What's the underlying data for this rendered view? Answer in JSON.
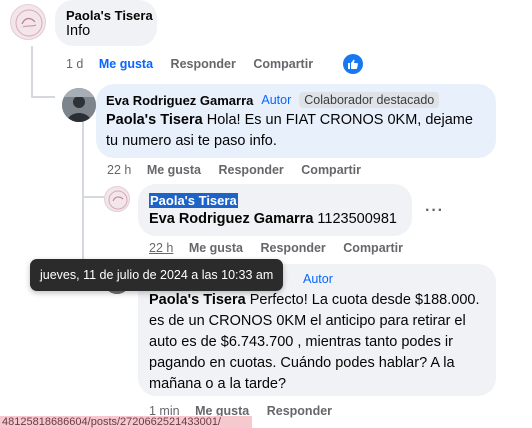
{
  "comments": {
    "c1": {
      "author": "Paola's Tisera",
      "text": "Info",
      "actions": {
        "time": "1 d",
        "like": "Me gusta",
        "reply": "Responder",
        "share": "Compartir"
      },
      "avatar_icon": "paola-logo-avatar"
    },
    "c2": {
      "author": "Eva Rodriguez Gamarra",
      "badge_author": "Autor",
      "badge_top": "Colaborador destacado",
      "mention": "Paola's Tisera",
      "text": " Hola! Es un FIAT CRONOS 0KM, dejame tu numero asi te paso info.",
      "actions": {
        "time": "22 h",
        "like": "Me gusta",
        "reply": "Responder",
        "share": "Compartir"
      }
    },
    "c3": {
      "author": "Paola's Tisera",
      "mention": "Eva Rodriguez Gamarra",
      "text": " 1123500981",
      "actions": {
        "time": "22 h",
        "like": "Me gusta",
        "reply": "Responder",
        "share": "Compartir"
      }
    },
    "c4": {
      "badge_author": "Autor",
      "mention": "Paola's Tisera",
      "text": " Perfecto! La cuota desde $188.000. es de un CRONOS 0KM el anticipo para retirar el auto es de $6.743.700 , mientras tanto podes ir pagando en cuotas. Cuándo podes hablar? A la mañana o a la tarde?",
      "actions": {
        "time": "1 min",
        "like": "Me gusta",
        "reply": "Responder"
      }
    }
  },
  "tooltip": "jueves, 11 de julio de 2024 a las 10:33 am",
  "more_button": "···",
  "status_url": "48125818686604/posts/2720662521433001/",
  "colors": {
    "link_blue": "#0866ff",
    "bubble": "#f0f2f5",
    "bubble_highlight": "#e7f0fb"
  }
}
